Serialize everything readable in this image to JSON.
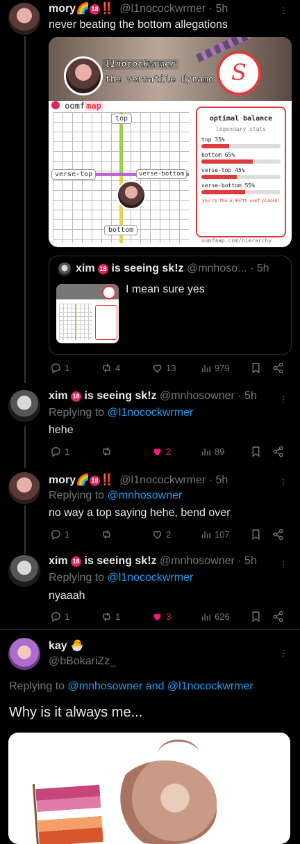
{
  "colors": {
    "accent": "#1d9bf0",
    "muted": "#71767b",
    "like": "#f91880",
    "bg": "#000000"
  },
  "tweet1": {
    "name": "mory🌈",
    "badge": "18",
    "marks": "‼️",
    "handle": "@l1nocockwrmer · 5h",
    "text": "never beating the bottom allegations",
    "card": {
      "handle": "l1nocockwrmer",
      "subtitle": "the versatile dynamo",
      "brand_prefix": "oomf",
      "brand_suffix": "map",
      "labels": {
        "top": "top",
        "bottom": "bottom",
        "left": "verse-top",
        "right": "verse-bottom"
      },
      "stats_title": "optimal balance",
      "stats_subtitle": "legendary stats",
      "stats": [
        {
          "label": "top 35%",
          "value": 35
        },
        {
          "label": "bottom 65%",
          "value": 65
        },
        {
          "label": "verse-top 45%",
          "value": 45
        },
        {
          "label": "verse-bottom 55%",
          "value": 55
        }
      ],
      "footnote": "you're the 6,407th oomf placed!",
      "url": "oomfmap.com/hierarchy"
    },
    "quote": {
      "name": "xim",
      "badge": "18",
      "name_suffix": "is seeing sk!z",
      "handle": "@mnhoso...",
      "time": "· 5h",
      "text": "I mean sure yes"
    },
    "actions": {
      "replies": "1",
      "retweets": "4",
      "likes": "13",
      "views": "979"
    }
  },
  "tweet2": {
    "name": "xim",
    "badge": "18",
    "name_suffix": "is seeing sk!z",
    "handle": "@mnhosowner · 5h",
    "replying_prefix": "Replying to",
    "replying_to": "@l1nocockwrmer",
    "text": "hehe",
    "actions": {
      "replies": "1",
      "retweets": "",
      "likes": "2",
      "views": "89"
    }
  },
  "tweet3": {
    "name": "mory🌈",
    "badge": "18",
    "marks": "‼️",
    "handle": "@l1nocockwrmer · 5h",
    "replying_prefix": "Replying to",
    "replying_to": "@mnhosowner",
    "text": "no way a top saying hehe, bend over",
    "actions": {
      "replies": "1",
      "retweets": "",
      "likes": "2",
      "views": "107"
    }
  },
  "tweet4": {
    "name": "xim",
    "badge": "18",
    "name_suffix": "is seeing sk!z",
    "handle": "@mnhosowner · 5h",
    "replying_prefix": "Replying to",
    "replying_to": "@l1nocockwrmer",
    "text": "nyaaah",
    "actions": {
      "replies": "1",
      "retweets": "1",
      "likes": "3",
      "views": "626"
    }
  },
  "tweet5": {
    "name": "kay 🐣",
    "handle": "@bBokariZz_",
    "replying_prefix": "Replying to",
    "replying_to": "@mnhosowner and @l1nocockwrmer",
    "text": "Why is it always me..."
  }
}
